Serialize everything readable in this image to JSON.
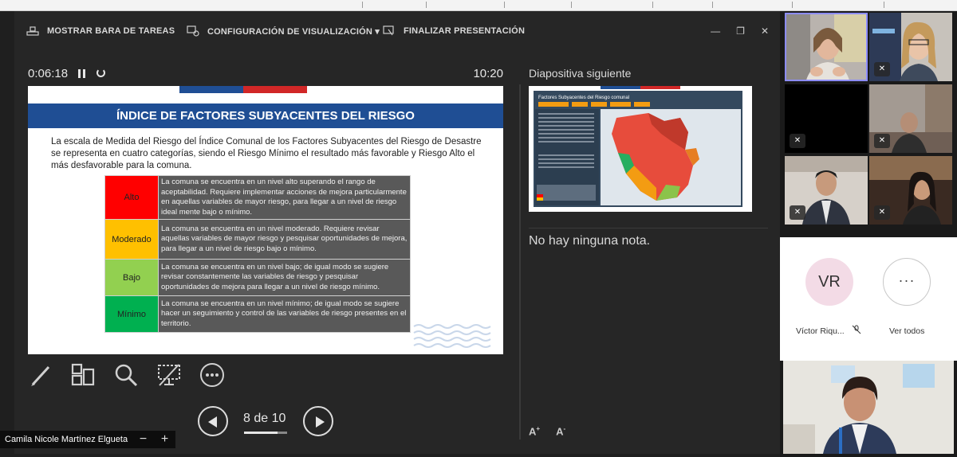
{
  "toolbar": {
    "taskbar_label": "MOSTRAR BARA DE TAREAS",
    "display_label": "CONFIGURACIÓN DE VISUALIZACIÓN ▾",
    "end_label": "FINALIZAR PRESENTACIÓN"
  },
  "timer": {
    "elapsed": "0:06:18",
    "clock": "10:20"
  },
  "slide": {
    "title": "ÍNDICE DE FACTORES SUBYACENTES DEL RIESGO",
    "intro": "La escala de Medida del Riesgo del Índice Comunal de los Factores Subyacentes del Riesgo de Desastre se representa en cuatro categorías, siendo el Riesgo Mínimo el resultado más favorable y Riesgo Alto el más desfavorable para la comuna.",
    "levels": [
      {
        "label": "Alto",
        "color": "#ff0000",
        "text": "La comuna se encuentra en un nivel alto superando el rango de aceptabilidad. Requiere implementar acciones de mejora particularmente en aquellas variables de mayor riesgo, para llegar a un nivel de riesgo ideal mente bajo o mínimo."
      },
      {
        "label": "Moderado",
        "color": "#ffc000",
        "text": "La comuna se encuentra en un nivel moderado. Requiere revisar aquellas variables de mayor riesgo y pesquisar oportunidades de mejora, para llegar a un nivel de riesgo bajo o mínimo."
      },
      {
        "label": "Bajo",
        "color": "#92d050",
        "text": "La comuna se encuentra en un nivel bajo; de igual modo se sugiere revisar constantemente las variables de riesgo y pesquisar oportunidades de mejora para llegar a un nivel de riesgo mínimo."
      },
      {
        "label": "Mínimo",
        "color": "#00b050",
        "text": "La comuna se encuentra en un nivel mínimo; de igual modo se sugiere hacer un seguimiento y control de las variables de riesgo presentes en el territorio."
      }
    ]
  },
  "pagination": {
    "label": "8 de 10"
  },
  "next_slide": {
    "label": "Diapositiva siguiente",
    "title": "Factores Subyacentes del Riesgo comunal"
  },
  "notes": {
    "empty": "No hay ninguna nota."
  },
  "presenter_name": "Camila Nicole Martínez Elgueta",
  "participants": {
    "avatar_initials": "VR",
    "avatar_name": "Víctor Riqu...",
    "more_label": "Ver todos",
    "more_glyph": "···"
  },
  "colors": {
    "accent": "#1f4e94",
    "flag_blue": "#1f4e94",
    "flag_red": "#d12727"
  }
}
